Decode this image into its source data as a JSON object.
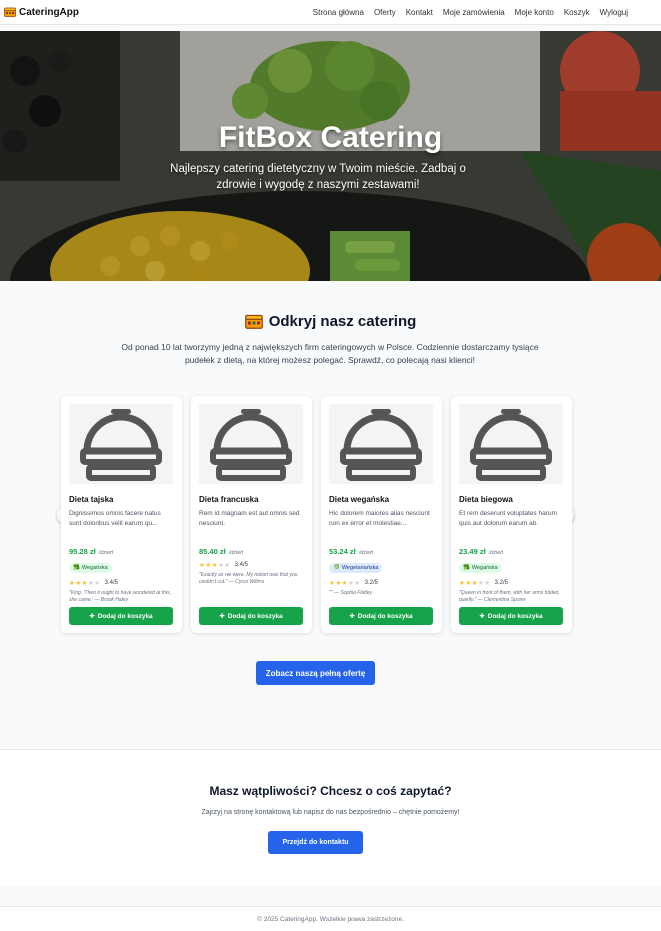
{
  "nav": {
    "brand": "CateringApp",
    "brand_icon": "catering-box-icon",
    "items": [
      "Strona główna",
      "Oferty",
      "Kontakt",
      "Moje zamówienia",
      "Moje konto",
      "Koszyk",
      "Wyloguj"
    ]
  },
  "hero": {
    "title": "FitBox Catering",
    "subtitle": "Najlepszy catering dietetyczny w Twoim mieście. Zadbaj o zdrowie i wygodę z naszymi zestawami!"
  },
  "discover": {
    "title": "Odkryj nasz catering",
    "icon": "catering-box-icon",
    "text": "Od ponad 10 lat tworzymy jedną z największych firm cateringowych w Polsce. Codziennie dostarczamy tysiące pudełek z dietą, na której możesz polegać. Sprawdź, co polecają nasi klienci!"
  },
  "cards": [
    {
      "name": "Dieta tajska",
      "desc": "Dignissimos omnis facere natus sunt doloribus velit earum qu...",
      "price": "95.28 zł",
      "per": "/dzień",
      "badge": "Wegańska",
      "rating": "3.4/5",
      "stars": 3,
      "quote": "\"King. 'Then it ought to have wondered at this, she came.' — Brook Haley"
    },
    {
      "name": "Dieta francuska",
      "desc": "Rem id magnam est aut omnis sed nesciunt.",
      "price": "85.40 zł",
      "per": "/dzień",
      "badge": "",
      "rating": "3.4/5",
      "stars": 3,
      "quote": "\"Exactly as we were. My notion was that you couldn't cut.\" — Cyrus Willms"
    },
    {
      "name": "Dieta wegańska",
      "desc": "Hic dolorem maiores alias nesciunt non ex error et molestiae...",
      "price": "53.24 zł",
      "per": "/dzień",
      "badge": "Wegetariańska",
      "rating": "3.2/5",
      "stars": 3,
      "quote": "\"\" — Sophia Flatley"
    },
    {
      "name": "Dieta biegowa",
      "desc": "Et rem deserunt voluptates harum quis aut dolorum earum ab.",
      "price": "23.49 zł",
      "per": "/dzień",
      "badge": "Wegańska",
      "rating": "3.2/5",
      "stars": 3,
      "quote": "\"Queen in front of them, with her arms folded, quietly.\" — Clementina Sporer"
    }
  ],
  "add_label": "Dodaj do koszyka",
  "offer_button": "Zobacz naszą pełną ofertę",
  "contact": {
    "title": "Masz wątpliwości? Chcesz o coś zapytać?",
    "text": "Zajrzyj na stronę kontaktową lub napisz do nas bezpośrednio – chętnie pomożemy!",
    "button": "Przejdź do kontaktu"
  },
  "footer": "© 2025 CateringApp. Wszelkie prawa zastrzeżone.",
  "colors": {
    "green": "#16a34a",
    "blue": "#2563eb"
  }
}
